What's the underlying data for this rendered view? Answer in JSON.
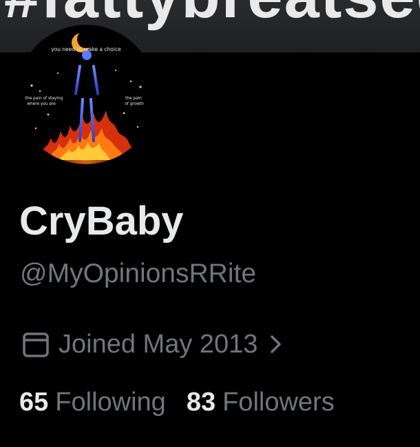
{
  "banner": {
    "text": "#fattybreatsecamshot"
  },
  "avatar": {
    "top_text": "you need to make a choice",
    "left_text_line1": "the pain of staying",
    "left_text_line2": "where you are",
    "right_text_line1": "the pain",
    "right_text_line2": "of growth"
  },
  "profile": {
    "display_name": "CryBaby",
    "handle": "@MyOpinionsRRite",
    "joined": "Joined May 2013"
  },
  "stats": {
    "following_count": "65",
    "following_label": "Following",
    "followers_count": "83",
    "followers_label": "Followers"
  },
  "colors": {
    "background": "#000000",
    "primary_text": "#e7e9ea",
    "secondary_text": "#71767b"
  }
}
